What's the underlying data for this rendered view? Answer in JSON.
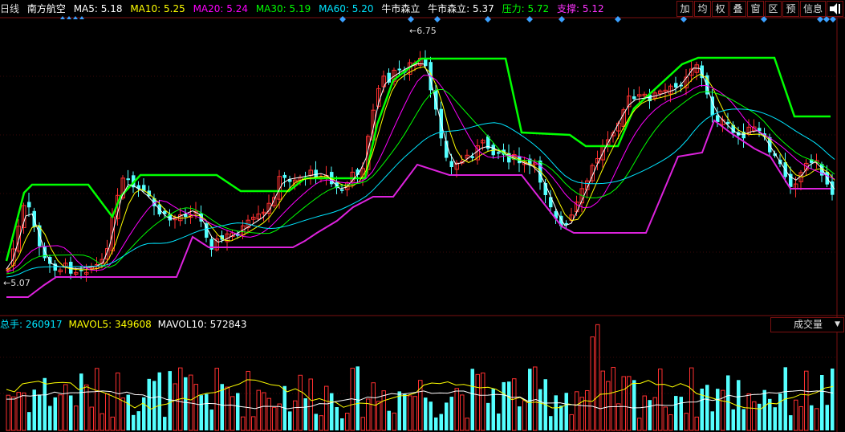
{
  "header": {
    "period": "日线",
    "stock_name": "南方航空",
    "ma5": {
      "label": "MA5:",
      "value": "5.18",
      "color": "#ffffff"
    },
    "ma10": {
      "label": "MA10:",
      "value": "5.25",
      "color": "#ffff00"
    },
    "ma20": {
      "label": "MA20:",
      "value": "5.24",
      "color": "#ff00ff"
    },
    "ma30": {
      "label": "MA30:",
      "value": "5.19",
      "color": "#00ff00"
    },
    "ma60": {
      "label": "MA60:",
      "value": "5.20",
      "color": "#00e5ff"
    },
    "indicator1": "牛市森立",
    "indicator2": {
      "label": "牛市森立:",
      "value": "5.37"
    },
    "pressure": {
      "label": "压力:",
      "value": "5.72",
      "color": "#00ff00"
    },
    "support": {
      "label": "支撑:",
      "value": "5.12",
      "color": "#ff33ff"
    }
  },
  "toolbar": {
    "buttons": [
      "加",
      "均",
      "权",
      "叠",
      "窗",
      "区",
      "预",
      "信息"
    ],
    "exit_icon": "exit-arrow-icon"
  },
  "price_labels": {
    "high": "6.75",
    "low": "5.07"
  },
  "volume_header": {
    "total": {
      "label": "总手:",
      "value": "260917",
      "color": "#00e5ff"
    },
    "mavol5": {
      "label": "MAVOL5:",
      "value": "349608",
      "color": "#ffff00"
    },
    "mavol10": {
      "label": "MAVOL10:",
      "value": "572843",
      "color": "#ffffff"
    }
  },
  "volume_selector": {
    "value": "成交量"
  },
  "colors": {
    "up": "#ff3030",
    "down": "#54ffff",
    "pressure": "#00ff00",
    "support": "#dd22dd",
    "grid": "#7a1010"
  }
}
